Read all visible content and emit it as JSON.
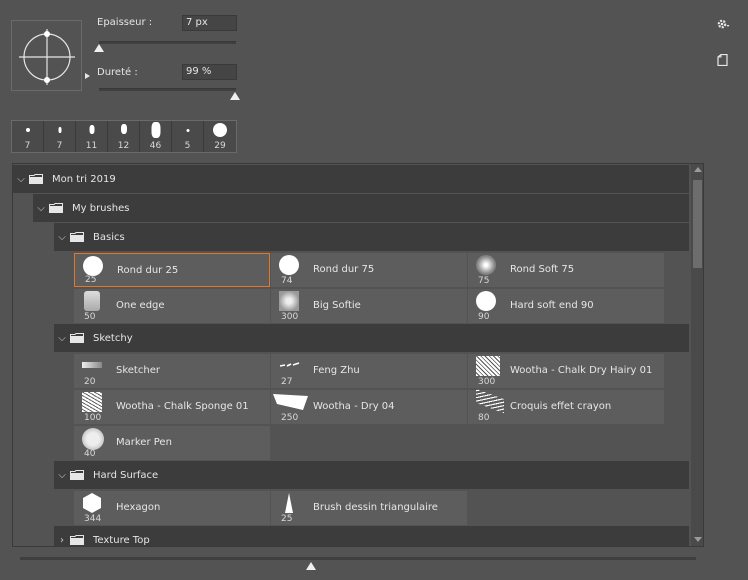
{
  "settings": {
    "thickness_label": "Epaisseur :",
    "thickness_value": "7 px",
    "thickness_slider": 0.0,
    "hardness_label": "Dureté :",
    "hardness_value": "99 %",
    "hardness_slider": 0.99
  },
  "recent_brushes": [
    "7",
    "7",
    "11",
    "12",
    "46",
    "5",
    "29"
  ],
  "tree": {
    "root": "Mon tri 2019",
    "sub": "My brushes",
    "groups": [
      {
        "label": "Basics",
        "brushes": [
          {
            "size": "25",
            "name": "Rond dur 25"
          },
          {
            "size": "74",
            "name": "Rond dur 75"
          },
          {
            "size": "75",
            "name": "Rond Soft 75"
          },
          {
            "size": "50",
            "name": "One edge"
          },
          {
            "size": "300",
            "name": "Big Softie"
          },
          {
            "size": "90",
            "name": "Hard soft end 90"
          }
        ]
      },
      {
        "label": "Sketchy",
        "brushes": [
          {
            "size": "20",
            "name": "Sketcher"
          },
          {
            "size": "27",
            "name": "Feng Zhu"
          },
          {
            "size": "300",
            "name": "Wootha - Chalk Dry Hairy 01"
          },
          {
            "size": "100",
            "name": "Wootha - Chalk Sponge 01"
          },
          {
            "size": "250",
            "name": "Wootha - Dry 04"
          },
          {
            "size": "80",
            "name": "Croquis effet crayon"
          },
          {
            "size": "40",
            "name": "Marker Pen"
          }
        ]
      },
      {
        "label": "Hard Surface",
        "brushes": [
          {
            "size": "344",
            "name": "Hexagon"
          },
          {
            "size": "25",
            "name": "Brush dessin triangulaire"
          }
        ]
      },
      {
        "label": "Texture Top",
        "brushes": []
      }
    ]
  },
  "preview_slider": 0.43,
  "icons": {
    "settings": "gear-icon",
    "new_preset": "new-preset-icon",
    "folder": "folder-icon",
    "chevron": "chevron-icon"
  },
  "colors": {
    "selection": "#e2772a",
    "panel": "#535353",
    "group_row": "#3c3c3c",
    "cell": "#5d5d5d"
  }
}
